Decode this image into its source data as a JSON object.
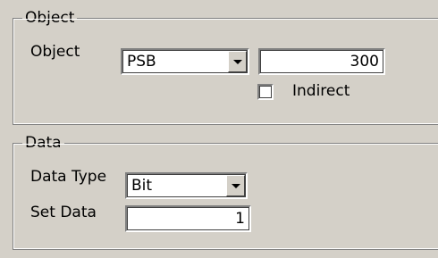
{
  "object_group": {
    "title": "Object",
    "object_label": "Object",
    "object_type": "PSB",
    "object_address": "300",
    "indirect_label": "Indirect",
    "indirect_checked": false
  },
  "data_group": {
    "title": "Data",
    "data_type_label": "Data Type",
    "data_type": "Bit",
    "set_data_label": "Set Data",
    "set_data_value": "1"
  },
  "icons": {
    "dropdown_arrow": "chevron-down-icon"
  }
}
